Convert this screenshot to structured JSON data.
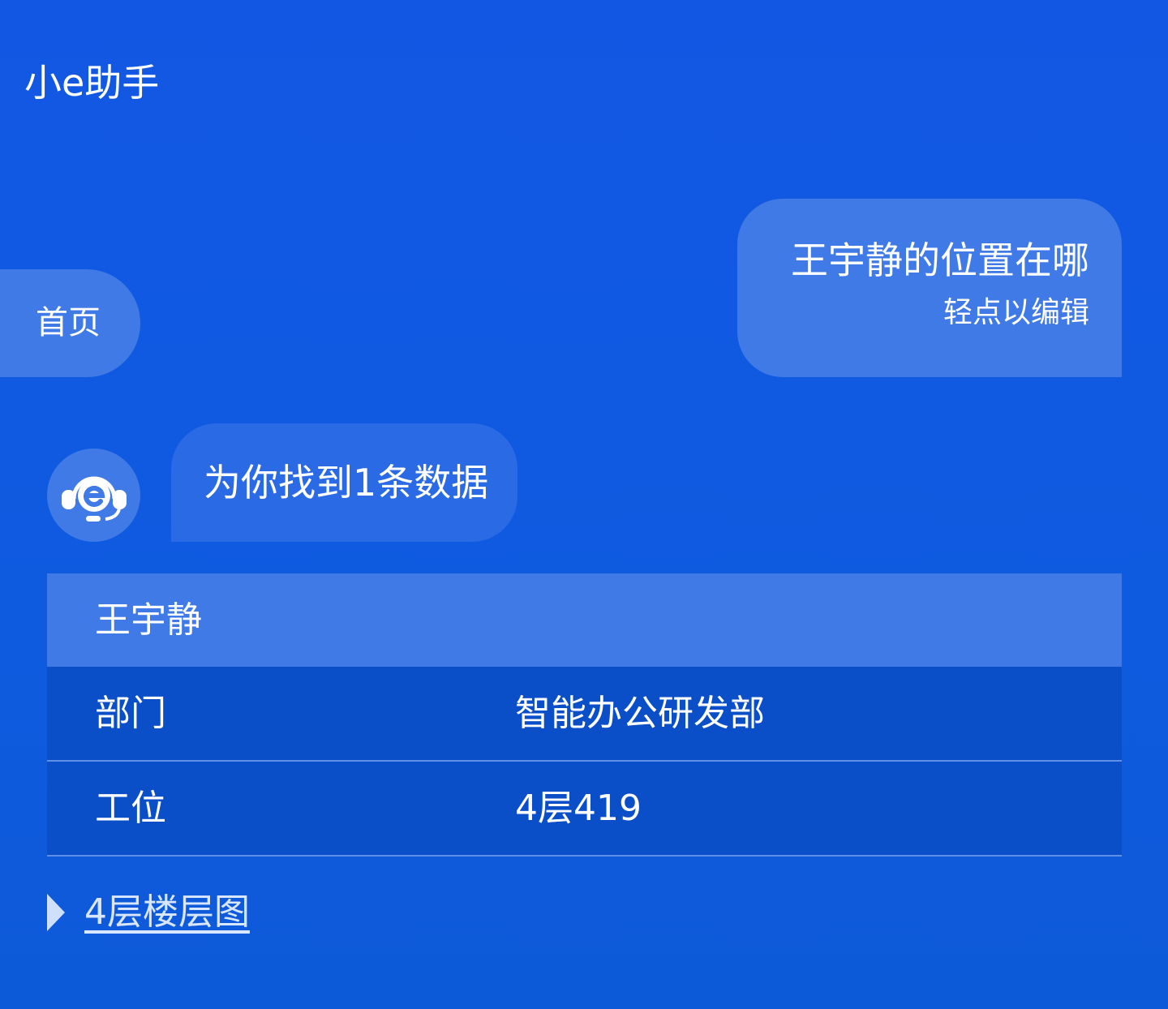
{
  "header": {
    "title": "小e助手"
  },
  "home_button": {
    "label": "首页"
  },
  "user_message": {
    "text": "王宇静的位置在哪",
    "edit_hint": "轻点以编辑"
  },
  "bot_message": {
    "avatar_icon": "headset-e-icon",
    "text": "为你找到1条数据"
  },
  "result_card": {
    "name": "王宇静",
    "rows": [
      {
        "label": "部门",
        "value": "智能办公研发部"
      },
      {
        "label": "工位",
        "value": "4层419"
      }
    ]
  },
  "floor_map_link": {
    "icon": "triangle-right-icon",
    "label": "4层楼层图"
  },
  "colors": {
    "background": "#1257e3",
    "bubble": "#3f7ae6",
    "bot_bubble": "#2a6ae5",
    "table_row": "#0b4fc8",
    "divider": "#5f8fe6"
  }
}
